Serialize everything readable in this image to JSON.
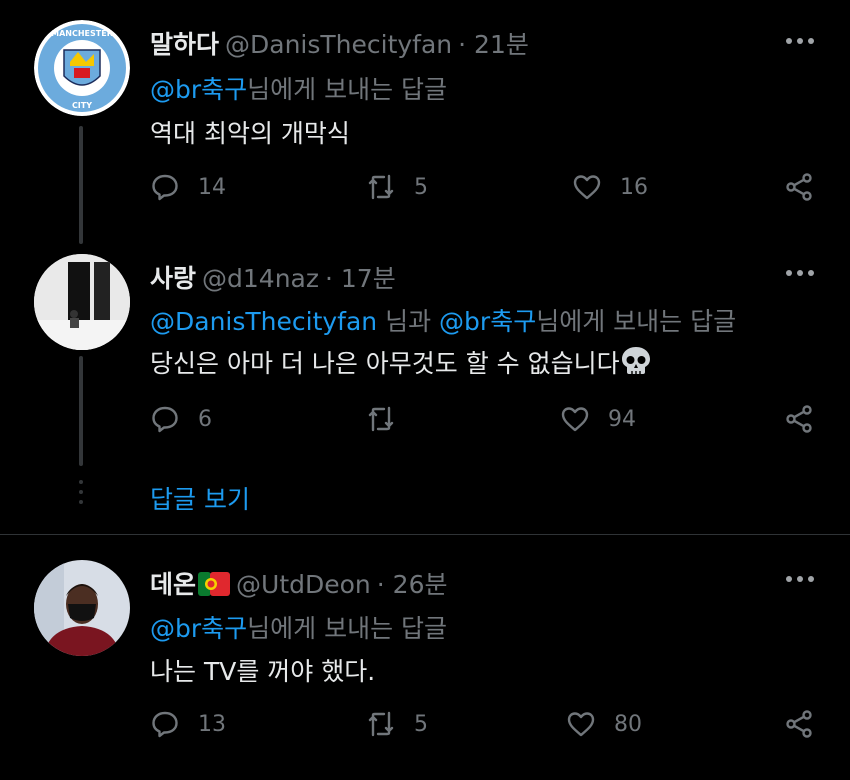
{
  "tweets": [
    {
      "name": "말하다",
      "handle": "@DanisThecityfan",
      "time": "· 21분",
      "reply_mentions": [
        "@br축구"
      ],
      "reply_connectors": [],
      "reply_suffix": "님에게 보내는 답글",
      "text": "역대 최악의 개막식",
      "replies": "14",
      "retweets": "5",
      "likes": "16",
      "avatar": "manchester-city-crest",
      "avatar_text_top": "MANCHESTER",
      "avatar_text_bottom": "CITY"
    },
    {
      "name": "사랑",
      "handle": "@d14naz",
      "time": "· 17분",
      "reply_mentions": [
        "@DanisThecityfan",
        "@br축구"
      ],
      "reply_connectors": [
        " 님과 "
      ],
      "reply_suffix": "님에게 보내는 답글",
      "text": "당신은 아마 더 나은 아무것도 할 수 없습니다",
      "text_emoji": "skull",
      "replies": "6",
      "retweets": "",
      "likes": "94",
      "avatar": "person-in-white-room"
    },
    {
      "name": "데온",
      "name_flag": "portugal-flag",
      "handle": "@UtdDeon",
      "time": "· 26분",
      "reply_mentions": [
        "@br축구"
      ],
      "reply_connectors": [],
      "reply_suffix": "님에게 보내는 답글",
      "text": "나는 TV를 꺼야 했다.",
      "replies": "13",
      "retweets": "5",
      "likes": "80",
      "avatar": "person-with-mask"
    }
  ],
  "show_replies_label": "답글 보기",
  "colors": {
    "background": "#000000",
    "text": "#e7e9ea",
    "muted": "#71767b",
    "accent": "#1d9bf0"
  }
}
